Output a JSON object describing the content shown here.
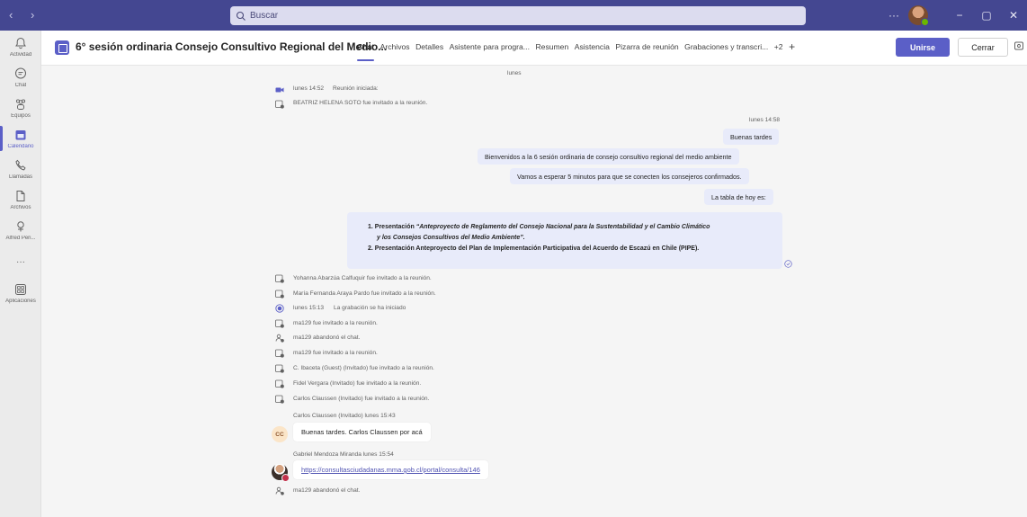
{
  "titlebar": {
    "search_placeholder": "Buscar",
    "more_label": "···",
    "minimize_label": "−",
    "maximize_label": "▢",
    "close_label": "✕"
  },
  "rail": {
    "items": [
      {
        "label": "Actividad",
        "icon": "bell-icon"
      },
      {
        "label": "Chat",
        "icon": "chat-icon"
      },
      {
        "label": "Equipos",
        "icon": "teams-icon"
      },
      {
        "label": "Calendario",
        "icon": "calendar-icon"
      },
      {
        "label": "Llamadas",
        "icon": "phone-icon"
      },
      {
        "label": "Archivos",
        "icon": "file-icon"
      },
      {
        "label": "Alfred Peri...",
        "icon": "app-icon"
      },
      {
        "label": "Aplicaciones",
        "icon": "apps-icon"
      }
    ],
    "more_label": "···"
  },
  "header": {
    "title": "6° sesión ordinaria Consejo Consultivo Regional del Medio...",
    "tabs": [
      "Chat",
      "Archivos",
      "Detalles",
      "Asistente para progra...",
      "Resumen",
      "Asistencia",
      "Pizarra de reunión",
      "Grabaciones y transcri...",
      "+2"
    ],
    "join_label": "Unirse",
    "close_label": "Cerrar"
  },
  "chat": {
    "date_separator": "lunes",
    "meeting_started": {
      "time": "lunes 14:52",
      "text": "Reunión iniciada:"
    },
    "invite_beatriz": "BEATRIZ HELENA SOTO fue invitado a la reunión.",
    "my_timestamp": "lunes 14:58",
    "my_messages": [
      "Buenas tardes",
      "Bienvenidos a la 6 sesión ordinaria de consejo consultivo regional del medio ambiente",
      "Vamos a esperar 5 minutos para que se conecten los consejeros confirmados.",
      "La tabla de hoy es:"
    ],
    "list_items": {
      "item1_prefix": "1. Presentación ",
      "item1_italic_line1": "“Anteproyecto de Reglamento del Consejo Nacional para la Sustentabilidad y el Cambio Climático",
      "item1_italic_line2": "y los Consejos Consultivos del Medio Ambiente”.",
      "item2": "2. Presentación Anteproyecto del Plan de Implementación Participativa del Acuerdo de Escazú en Chile (PIPE)."
    },
    "events": [
      "Yohanna Abarzúa Calfuquir fue invitado a la reunión.",
      "María Fernanda Araya Pardo fue invitado a la reunión.",
      "ma129 fue invitado a la reunión.",
      "ma129 abandonó el chat.",
      "ma129 fue invitado a la reunión.",
      "C. Ibaceta (Guest) (Invitado) fue invitado a la reunión.",
      "Fidel Vergara (Invitado) fue invitado a la reunión.",
      "Carlos Claussen (Invitado) fue invitado a la reunión."
    ],
    "recording": {
      "time": "lunes 15:13",
      "text": "La grabación se ha iniciado"
    },
    "carlos": {
      "header": "Carlos Claussen (Invitado)  lunes 15:43",
      "initials": "CC",
      "message": "Buenas tardes. Carlos Claussen por acá"
    },
    "gabriel": {
      "header": "Gabriel Mendoza Miranda  lunes 15:54",
      "link": "https://consultasciudadanas.mma.gob.cl/portal/consulta/146"
    },
    "last_event": "ma129 abandonó el chat."
  }
}
